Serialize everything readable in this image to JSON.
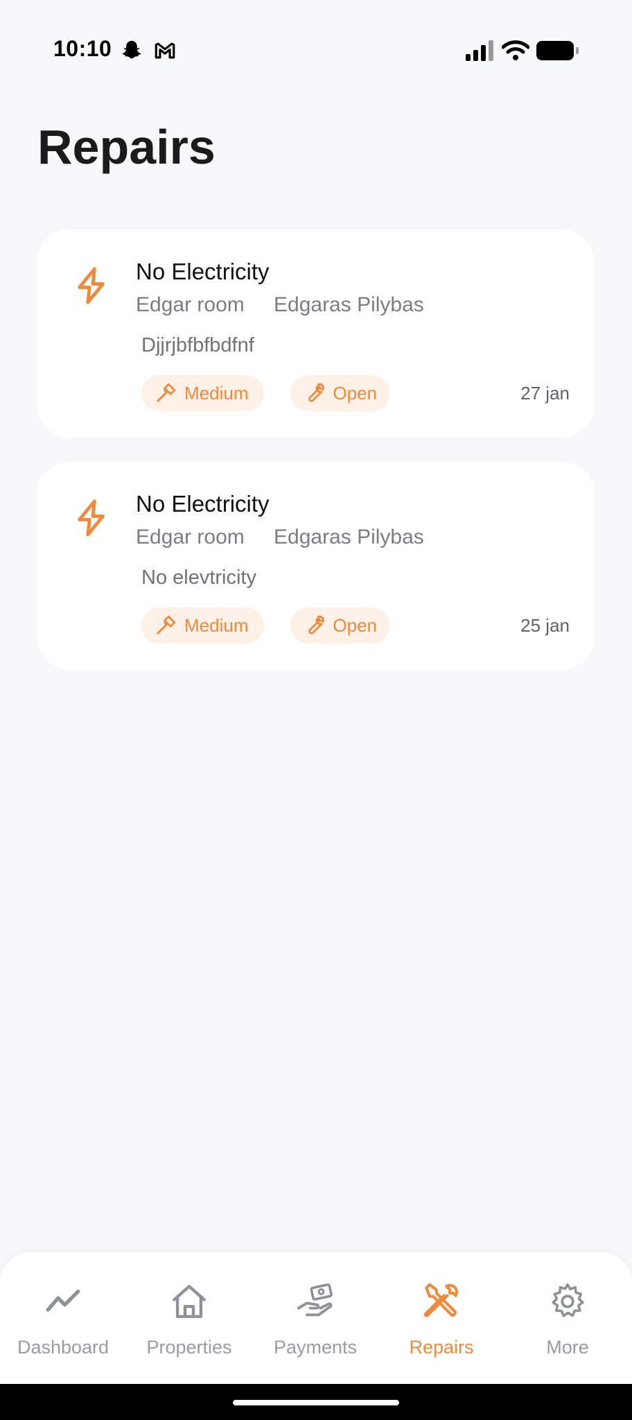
{
  "status_bar": {
    "time": "10:10"
  },
  "page": {
    "title": "Repairs"
  },
  "repairs": [
    {
      "title": "No Electricity",
      "location": "Edgar room",
      "tenant": "Edgaras Pilybas",
      "description": "Djjrjbfbfbdfnf",
      "priority": "Medium",
      "status": "Open",
      "date": "27 jan",
      "icon": "lightning-icon"
    },
    {
      "title": "No Electricity",
      "location": "Edgar room",
      "tenant": "Edgaras Pilybas",
      "description": "No elevtricity",
      "priority": "Medium",
      "status": "Open",
      "date": "25 jan",
      "icon": "lightning-icon"
    }
  ],
  "nav": {
    "active": "Repairs",
    "items": [
      {
        "label": "Dashboard",
        "icon": "trend-line-icon"
      },
      {
        "label": "Properties",
        "icon": "house-icon"
      },
      {
        "label": "Payments",
        "icon": "payment-hand-icon"
      },
      {
        "label": "Repairs",
        "icon": "tools-icon"
      },
      {
        "label": "More",
        "icon": "gear-icon"
      }
    ]
  },
  "colors": {
    "accent": "#ef8a3c",
    "chip_bg": "#fdf0e6",
    "background": "#f7f8fa",
    "muted": "#9a9ca1"
  }
}
